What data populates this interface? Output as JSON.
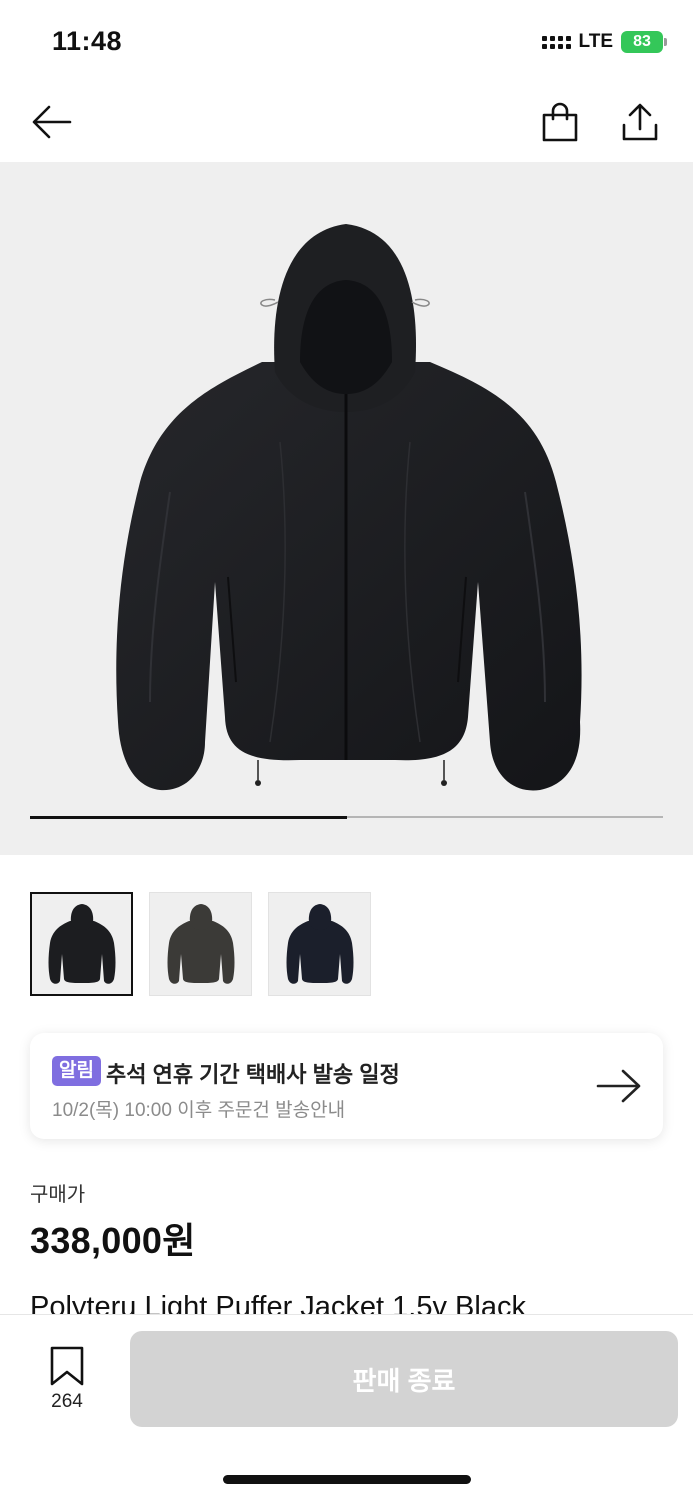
{
  "status_bar": {
    "time": "11:48",
    "network": "LTE",
    "battery": "83"
  },
  "nav": {
    "back_icon": "arrow-left-icon",
    "bag_icon": "shopping-bag-icon",
    "share_icon": "share-icon"
  },
  "gallery": {
    "progress_fraction": 0.5,
    "thumbnails": [
      {
        "color": "#1c1d20",
        "selected": true
      },
      {
        "color": "#3b3a37",
        "selected": false
      },
      {
        "color": "#1b1f2b",
        "selected": false
      }
    ]
  },
  "notice": {
    "badge": "알림",
    "title": "추석 연휴 기간 택배사 발송 일정",
    "subtitle": "10/2(목) 10:00 이후 주문건 발송안내",
    "arrow_icon": "arrow-right-icon"
  },
  "price": {
    "label": "구매가",
    "value": "338,000원"
  },
  "product": {
    "name": "Polyteru Light Puffer Jacket 1.5v Black"
  },
  "bottom": {
    "wish_icon": "bookmark-icon",
    "wish_count": "264",
    "cta_label": "판매 종료"
  }
}
